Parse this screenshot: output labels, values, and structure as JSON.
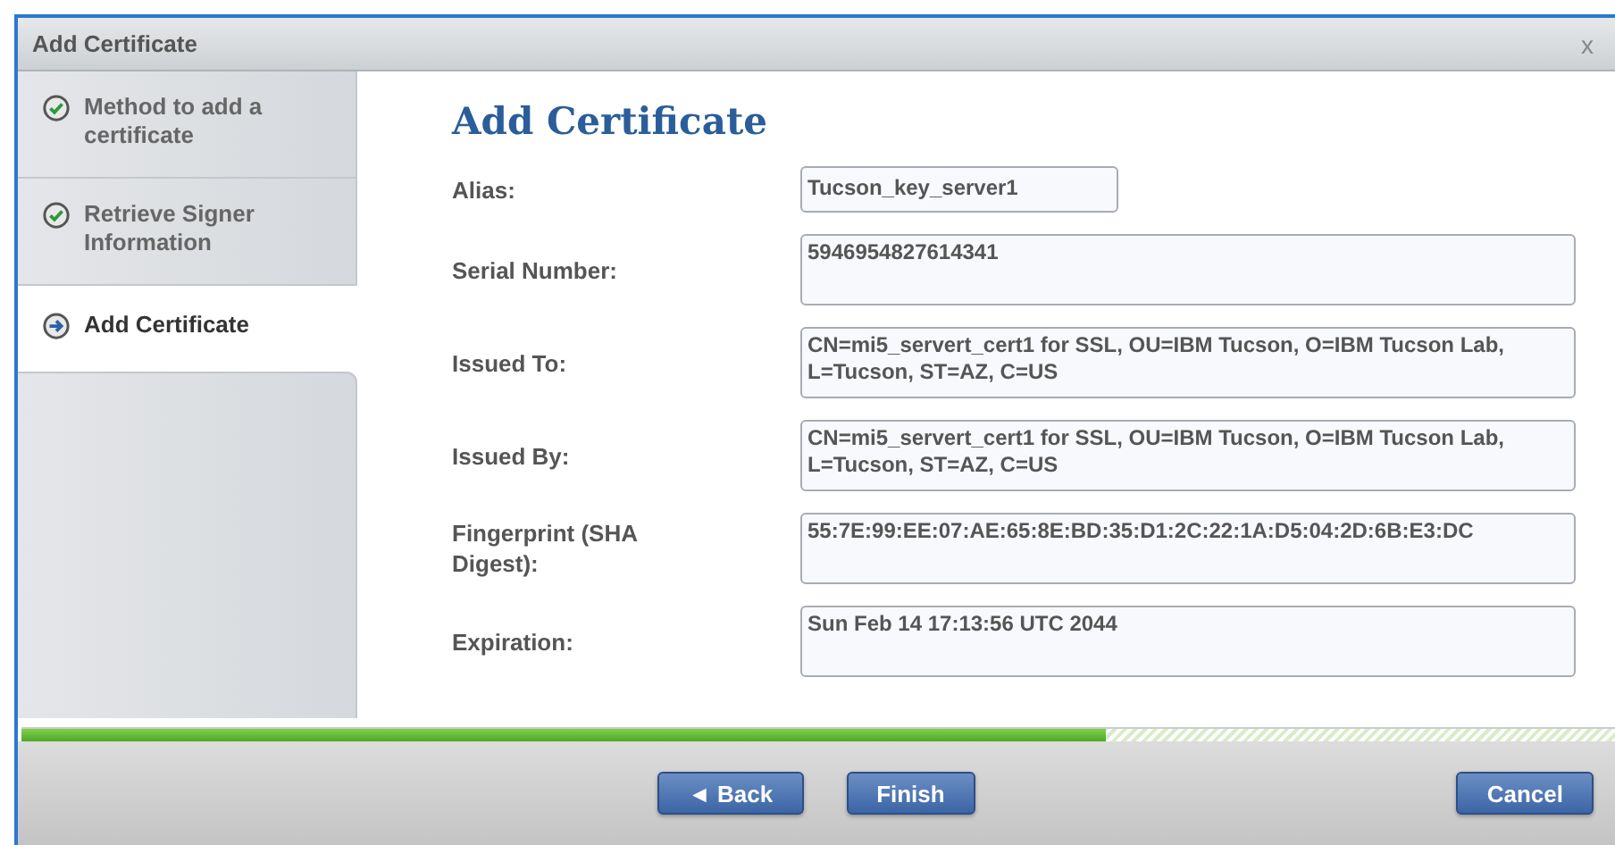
{
  "window": {
    "title": "Add Certificate",
    "close": "x"
  },
  "steps": [
    {
      "label": "Method to add a certificate",
      "kind": "done",
      "selected": false
    },
    {
      "label": "Retrieve Signer Information",
      "kind": "done",
      "selected": false
    },
    {
      "label": "Add Certificate",
      "kind": "current",
      "selected": true
    }
  ],
  "heading": "Add Certificate",
  "fields": [
    {
      "label": "Alias:",
      "value": "Tucson_key_server1",
      "kind": "short"
    },
    {
      "label": "Serial Number:",
      "value": "5946954827614341",
      "kind": "long"
    },
    {
      "label": "Issued To:",
      "value": "CN=mi5_servert_cert1 for SSL, OU=IBM Tucson, O=IBM Tucson Lab, L=Tucson, ST=AZ, C=US",
      "kind": "long"
    },
    {
      "label": "Issued By:",
      "value": "CN=mi5_servert_cert1 for SSL, OU=IBM Tucson, O=IBM Tucson Lab, L=Tucson, ST=AZ, C=US",
      "kind": "long"
    },
    {
      "label": "Fingerprint (SHA Digest):",
      "value": "55:7E:99:EE:07:AE:65:8E:BD:35:D1:2C:22:1A:D5:04:2D:6B:E3:DC",
      "kind": "long"
    },
    {
      "label": "Expiration:",
      "value": "Sun Feb 14 17:13:56 UTC 2044",
      "kind": "long"
    }
  ],
  "progress": {
    "level": 0.68
  },
  "buttons": {
    "back": "◄ Back",
    "finish": "Finish",
    "cancel": "Cancel"
  }
}
